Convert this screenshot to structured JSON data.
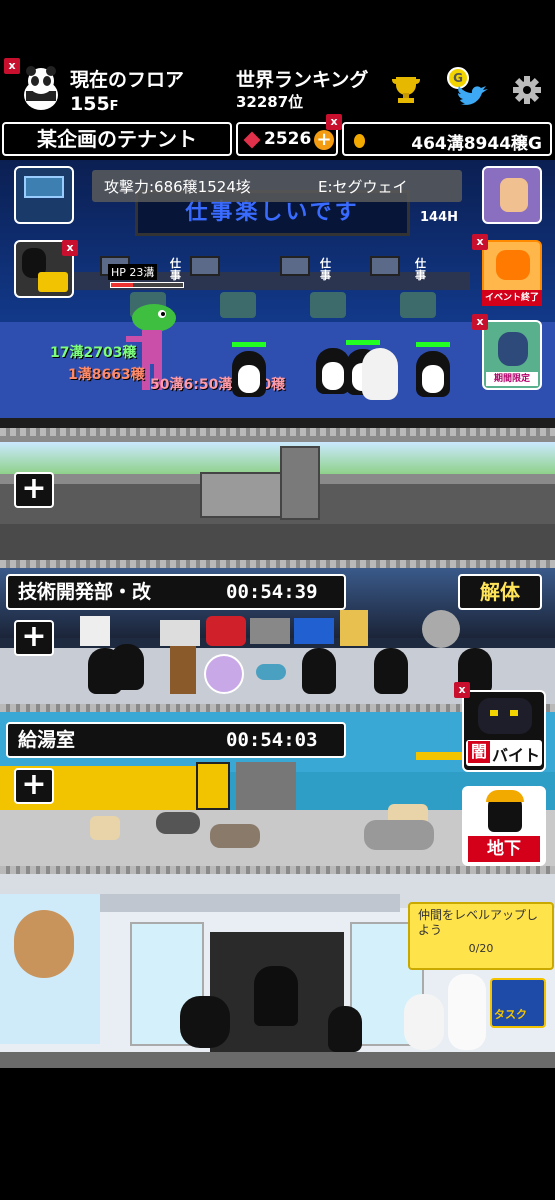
{
  "header": {
    "floor_label": "現在のフロア",
    "floor_value": "155",
    "floor_unit": "F",
    "ranking_label": "世界ランキング",
    "ranking_value": "32287位",
    "tenant_name": "某企画のテナント",
    "gems": "2526",
    "money": "464溝8944穣G",
    "badge": "x"
  },
  "battle": {
    "attack": "攻撃力:686穣1524垓",
    "equip": "E:セグウェイ",
    "banner": "仕事楽しいです",
    "hours": "144H",
    "hp": "HP 23溝",
    "damage1": "17溝2703穣",
    "damage2": "1溝8663穣",
    "damage3": "50溝6:50溝6500穣",
    "desk_sign": "仕事",
    "event_end": "イベント終了",
    "limited": "期間限定"
  },
  "floor_tech": {
    "name": "技術開発部・改",
    "timer": "00:54:39",
    "dismantle": "解体"
  },
  "floor_kitchen": {
    "name": "給湯室",
    "timer": "00:54:03",
    "yami_baito": "闇バイト",
    "yami_char": "闇",
    "baito": "バイト",
    "chika": "地下"
  },
  "lobby": {
    "quest_text": "仲間をレベルアップしよう",
    "quest_progress": "0/20",
    "task_label": "タスク"
  },
  "colors": {
    "office_bg": "#0a2a6e",
    "floor_grey": "#5a5a5a",
    "kitchen_bg": "#2e9ec7",
    "quest_yellow": "#ffe34a",
    "event_orange": "#ff8a00"
  }
}
